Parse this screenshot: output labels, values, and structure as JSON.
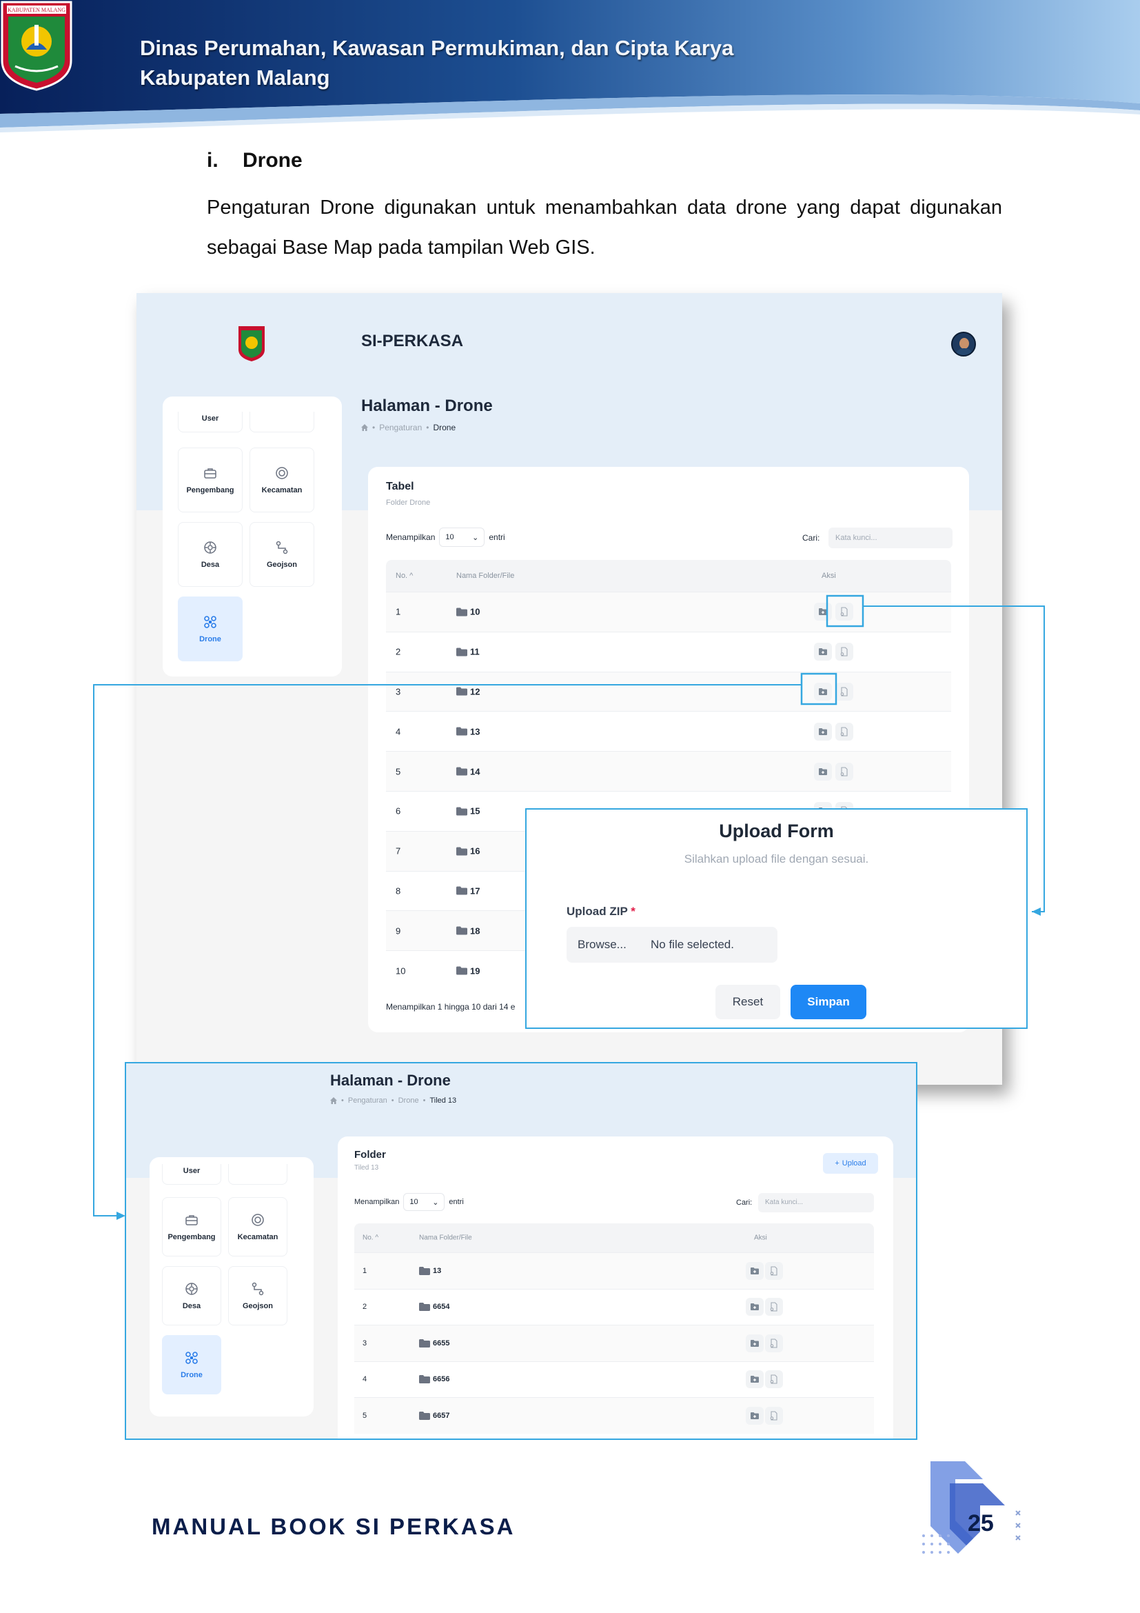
{
  "header": {
    "crest_text": "KABUPATEN MALANG",
    "org_line1": "Dinas Perumahan, Kawasan Permukiman, dan Cipta Karya",
    "org_line2": "Kabupaten Malang"
  },
  "section": {
    "number": "i.",
    "title": "Drone",
    "paragraph": "Pengaturan Drone digunakan untuk menambahkan data drone yang dapat digunakan sebagai Base Map pada tampilan Web GIS."
  },
  "shot1": {
    "app_title": "SI-PERKASA",
    "page_title": "Halaman - Drone",
    "breadcrumb": [
      "Pengaturan",
      "Drone"
    ],
    "sidebar": [
      {
        "label": "User",
        "icon": "user-icon"
      },
      {
        "label": "",
        "icon": ""
      },
      {
        "label": "Pengembang",
        "icon": "briefcase-icon"
      },
      {
        "label": "Kecamatan",
        "icon": "circle-target-icon"
      },
      {
        "label": "Desa",
        "icon": "crosshair-icon"
      },
      {
        "label": "Geojson",
        "icon": "route-icon"
      },
      {
        "label": "Drone",
        "icon": "drone-icon"
      }
    ],
    "card_title": "Tabel",
    "card_subtitle": "Folder Drone",
    "show_label": "Menampilkan",
    "page_size": "10",
    "entries_label": "entri",
    "search_label": "Cari:",
    "search_placeholder": "Kata kunci...",
    "columns": {
      "no": "No. ^",
      "name": "Nama Folder/File",
      "action": "Aksi"
    },
    "rows": [
      {
        "no": "1",
        "name": "10"
      },
      {
        "no": "2",
        "name": "11"
      },
      {
        "no": "3",
        "name": "12"
      },
      {
        "no": "4",
        "name": "13"
      },
      {
        "no": "5",
        "name": "14"
      },
      {
        "no": "6",
        "name": "15"
      },
      {
        "no": "7",
        "name": "16"
      },
      {
        "no": "8",
        "name": "17"
      },
      {
        "no": "9",
        "name": "18"
      },
      {
        "no": "10",
        "name": "19"
      }
    ],
    "footer": "Menampilkan 1 hingga 10 dari 14 e"
  },
  "upload_form": {
    "title": "Upload Form",
    "subtitle": "Silahkan upload file dengan sesuai.",
    "field_label": "Upload ZIP",
    "required_mark": "*",
    "browse_label": "Browse...",
    "file_status": "No file selected.",
    "reset_label": "Reset",
    "save_label": "Simpan"
  },
  "shot2": {
    "page_title": "Halaman - Drone",
    "breadcrumb": [
      "Pengaturan",
      "Drone",
      "Tiled 13"
    ],
    "card_title": "Folder",
    "card_subtitle": "Tiled 13",
    "upload_label": "Upload",
    "show_label": "Menampilkan",
    "page_size": "10",
    "entries_label": "entri",
    "search_label": "Cari:",
    "search_placeholder": "Kata kunci...",
    "columns": {
      "no": "No. ^",
      "name": "Nama Folder/File",
      "action": "Aksi"
    },
    "rows": [
      {
        "no": "1",
        "name": "13"
      },
      {
        "no": "2",
        "name": "6654"
      },
      {
        "no": "3",
        "name": "6655"
      },
      {
        "no": "4",
        "name": "6656"
      },
      {
        "no": "5",
        "name": "6657"
      }
    ]
  },
  "footer": {
    "title": "MANUAL BOOK SI PERKASA",
    "page_number": "25"
  },
  "colors": {
    "header_navy": "#0b2a66",
    "accent_blue": "#1e88f5",
    "callout": "#35a7e0",
    "footer_navy": "#0b1e4a"
  }
}
